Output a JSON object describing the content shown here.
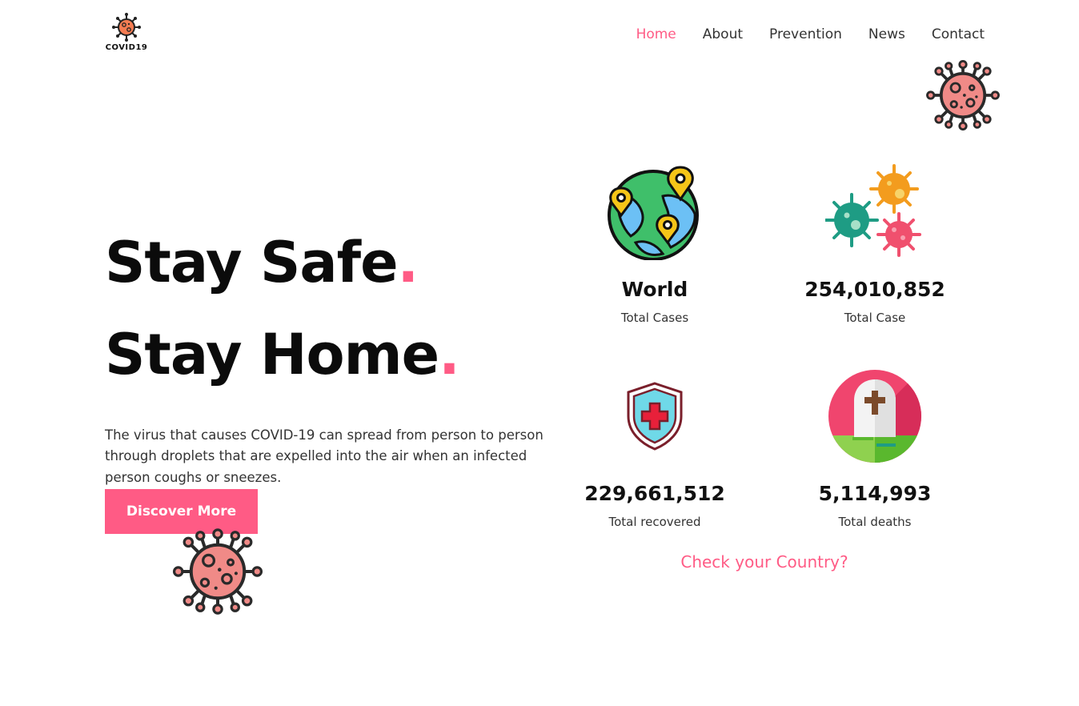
{
  "brand": {
    "logo_text": "COVID19"
  },
  "nav": {
    "items": [
      {
        "label": "Home",
        "active": true
      },
      {
        "label": "About",
        "active": false
      },
      {
        "label": "Prevention",
        "active": false
      },
      {
        "label": "News",
        "active": false
      },
      {
        "label": "Contact",
        "active": false
      }
    ]
  },
  "hero": {
    "line1": "Stay Safe",
    "line2": "Stay Home",
    "dot": ".",
    "description": "The virus that causes COVID-19 can spread from person to person through droplets that are expelled into the air when an infected person coughs or sneezes.",
    "cta_label": "Discover More"
  },
  "stats": [
    {
      "icon": "globe-icon",
      "value": "World",
      "label": "Total Cases"
    },
    {
      "icon": "viruses-icon",
      "value": "254,010,852",
      "label": "Total Case"
    },
    {
      "icon": "shield-cross-icon",
      "value": "229,661,512",
      "label": "Total recovered"
    },
    {
      "icon": "grave-icon",
      "value": "5,114,993",
      "label": "Total deaths"
    }
  ],
  "check_link": "Check your Country?",
  "colors": {
    "accent": "#ff5b85",
    "text": "#111111",
    "virus": "#f08a87"
  }
}
